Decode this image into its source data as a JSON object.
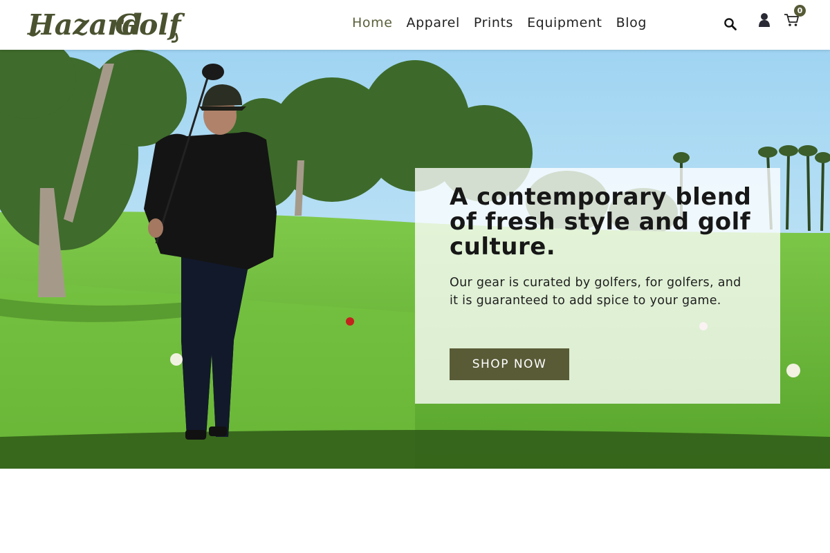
{
  "brand": {
    "name": "Hazard Golf",
    "logo_word1": "Hazard",
    "logo_word2": "Golf"
  },
  "colors": {
    "accent": "#5a5f3a",
    "cta_background": "#595b37",
    "badge_background": "#565a36",
    "panel_background": "rgba(255,255,255,0.78)",
    "nav_text": "#222222"
  },
  "nav": {
    "items": [
      {
        "label": "Home",
        "active": true
      },
      {
        "label": "Apparel",
        "active": false
      },
      {
        "label": "Prints",
        "active": false
      },
      {
        "label": "Equipment",
        "active": false
      },
      {
        "label": "Blog",
        "active": false
      }
    ]
  },
  "header_icons": {
    "search": "search-icon",
    "account": "user-icon",
    "cart": "cart-icon",
    "cart_count": "0"
  },
  "hero": {
    "image": "golfer-walking-on-course-photo",
    "headline": "A contemporary blend of fresh style and golf culture.",
    "subtext": "Our gear is curated by golfers, for golfers, and it is guaranteed to add spice to your game.",
    "cta_label": "SHOP NOW"
  }
}
